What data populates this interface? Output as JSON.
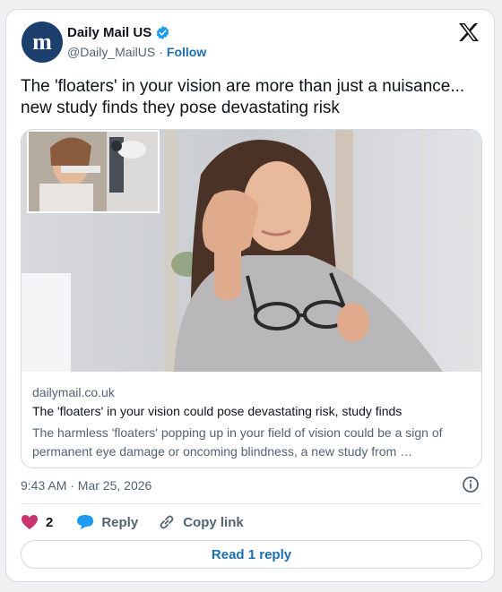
{
  "account": {
    "name": "Daily Mail US",
    "handle": "@Daily_MailUS",
    "separator": "·",
    "follow_label": "Follow",
    "verified": true
  },
  "tweet": {
    "text": "The 'floaters' in your vision are more than just a nuisance... new study finds they pose devastating risk",
    "timestamp": "9:43 AM · Mar 25, 2026"
  },
  "link_card": {
    "domain": "dailymail.co.uk",
    "title": "The 'floaters' in your vision could pose devastating risk, study finds",
    "description": "The harmless 'floaters' popping up in your field of vision could be a sign of permanent eye damage or oncoming blindness, a new study from …"
  },
  "actions": {
    "like_count": "2",
    "reply_label": "Reply",
    "copy_link_label": "Copy link"
  },
  "read_reply_label": "Read 1 reply",
  "colors": {
    "brand_avatar": "#1c3f6e",
    "link_blue": "#1d6fb0",
    "verified_blue": "#1d9bf0",
    "like_pink": "#c9346f",
    "reply_blue": "#1d9bf0"
  }
}
